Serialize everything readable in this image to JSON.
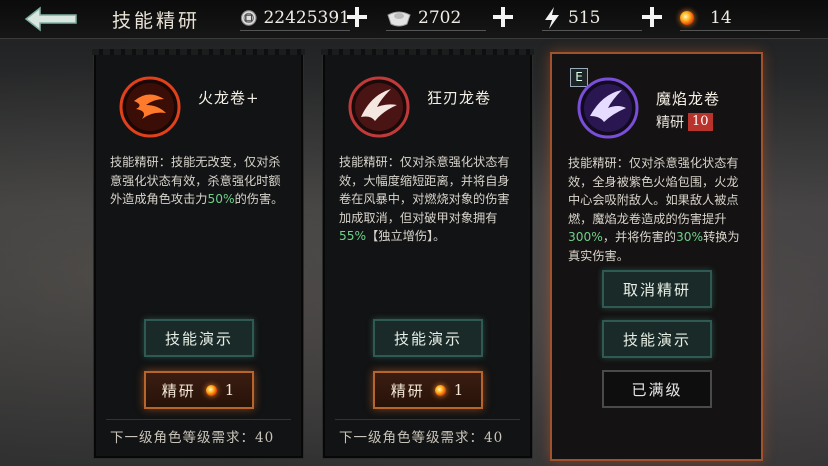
{
  "header": {
    "title": "技能精研",
    "resources": [
      {
        "icon": "coin-icon",
        "value": "22425391"
      },
      {
        "icon": "silver-ingot-icon",
        "value": "2702"
      },
      {
        "icon": "lightning-icon",
        "value": "515"
      },
      {
        "icon": "fire-orb-icon",
        "value": "14"
      }
    ]
  },
  "cards": [
    {
      "name": "火龙卷+",
      "description_parts": [
        "技能精研：技能无改变，仅对杀意强化状态有效，杀意强化时额外造成角色攻击力",
        "50%",
        "的伤害。"
      ],
      "demo_label": "技能演示",
      "refine_label": "精研",
      "refine_cost": "1",
      "requirement": "下一级角色等级需求：40",
      "emblem_color": "#e0401a"
    },
    {
      "name": "狂刃龙卷",
      "description_parts": [
        "技能精研：仅对杀意强化状态有效，大幅度缩短距离，并将自身卷在风暴中，对燃烧对象的伤害加成取消，但对破甲对象拥有",
        "55%",
        "【独立增伤】。"
      ],
      "demo_label": "技能演示",
      "refine_label": "精研",
      "refine_cost": "1",
      "requirement": "下一级角色等级需求：40",
      "emblem_color": "#c03a3a"
    },
    {
      "name": "魔焰龙卷",
      "badge": "E",
      "refine_text": "精研",
      "refine_level": "10",
      "description_parts": [
        "技能精研：仅对杀意强化状态有效，全身被紫色火焰包围，火龙中心会吸附敌人。如果敌人被点燃，魔焰龙卷造成的伤害提升",
        "300%",
        "，并将伤害的",
        "30%",
        "转换为真实伤害。"
      ],
      "cancel_label": "取消精研",
      "demo_label": "技能演示",
      "maxed_label": "已满级",
      "emblem_color": "#7a4fd8"
    }
  ],
  "colors": {
    "highlight": "#6fd08a",
    "selected_border": "#a0522d"
  }
}
